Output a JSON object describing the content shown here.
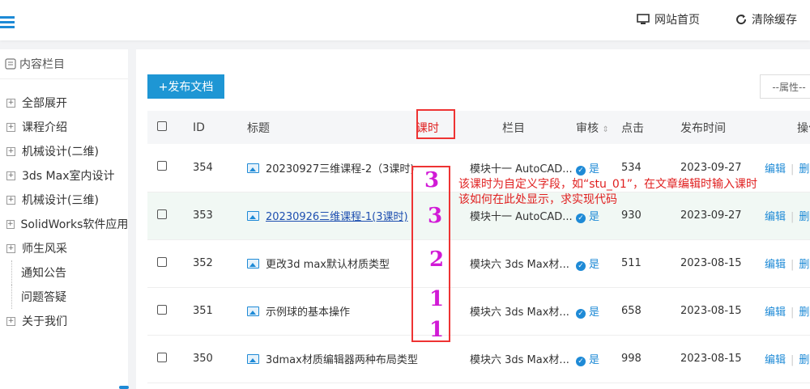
{
  "header": {
    "home_label": "网站首页",
    "clear_cache_label": "清除缓存"
  },
  "sidebar": {
    "title": "内容栏目",
    "items": [
      {
        "label": "全部展开",
        "type": "node"
      },
      {
        "label": "课程介绍",
        "type": "node"
      },
      {
        "label": "机械设计(二维)",
        "type": "node"
      },
      {
        "label": "3ds Max室内设计",
        "type": "node"
      },
      {
        "label": "机械设计(三维)",
        "type": "node"
      },
      {
        "label": "SolidWorks软件应用",
        "type": "node"
      },
      {
        "label": "师生风采",
        "type": "node"
      },
      {
        "label": "通知公告",
        "type": "leaf"
      },
      {
        "label": "问题答疑",
        "type": "leaf"
      },
      {
        "label": "关于我们",
        "type": "node"
      }
    ]
  },
  "toolbar": {
    "publish_label": "+发布文档",
    "attr_select": "--属性--"
  },
  "table": {
    "headers": {
      "id": "ID",
      "title": "标题",
      "lesson": "课时",
      "column": "栏目",
      "review": "审核",
      "clicks": "点击",
      "date": "发布时间",
      "ops": "操作"
    },
    "rows": [
      {
        "id": "354",
        "title": "20230927三维课程-2（3课时)",
        "column": "模块十一 AutoCAD...",
        "review": "是",
        "clicks": "534",
        "date": "2023-09-27",
        "link": false
      },
      {
        "id": "353",
        "title": "20230926三维课程-1(3课时)",
        "column": "模块十一 AutoCAD...",
        "review": "是",
        "clicks": "930",
        "date": "2023-09-27",
        "link": true
      },
      {
        "id": "352",
        "title": "更改3d max默认材质类型",
        "column": "模块六 3ds Max材...",
        "review": "是",
        "clicks": "511",
        "date": "2023-08-15",
        "link": false
      },
      {
        "id": "351",
        "title": "示例球的基本操作",
        "column": "模块六 3ds Max材...",
        "review": "是",
        "clicks": "658",
        "date": "2023-08-15",
        "link": false
      },
      {
        "id": "350",
        "title": "3dmax材质编辑器两种布局类型",
        "column": "模块六 3ds Max材...",
        "review": "是",
        "clicks": "998",
        "date": "2023-08-15",
        "link": false
      }
    ],
    "edit_label": "编辑",
    "delete_label": "删除"
  },
  "annotation": {
    "line1": "该课时为自定义字段，如“stu_01”，在文章编辑时输入课时",
    "line2": "该如何在此处显示，求实现代码",
    "handwritten": [
      "3",
      "3",
      "2",
      "1",
      "1"
    ],
    "color": "#e02020",
    "hand_color": "#d11ad6"
  }
}
